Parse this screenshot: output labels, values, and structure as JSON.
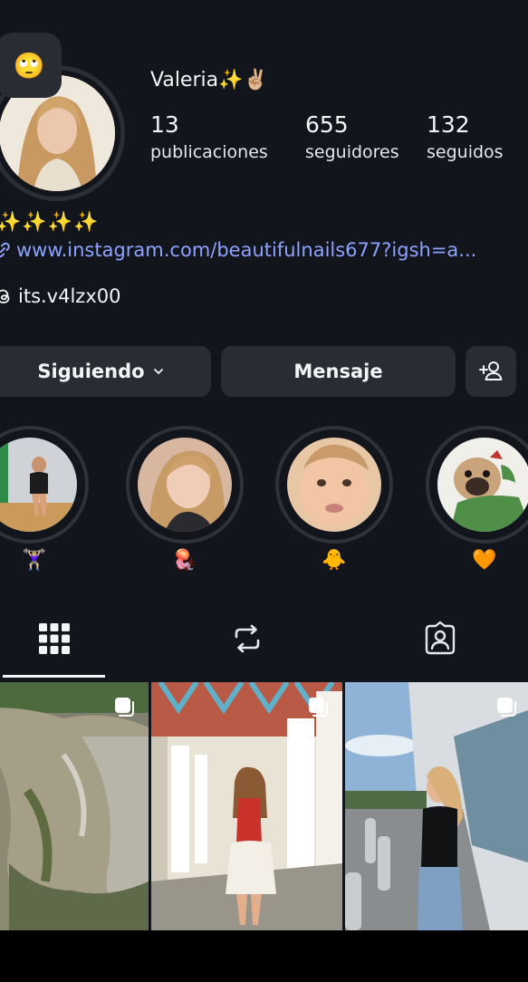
{
  "profile": {
    "note_emoji": "🙄",
    "username": "Valeria✨✌🏼",
    "stats": {
      "posts_count": "13",
      "posts_label": "publicaciones",
      "followers_count": "655",
      "followers_label": "seguidores",
      "following_count": "132",
      "following_label": "seguidos"
    },
    "bio_emoji": "✨✨✨✨",
    "link": "www.instagram.com/beautifulnails677?igsh=a...",
    "threads_handle": "its.v4lzx00"
  },
  "buttons": {
    "following_label": "Siguiendo",
    "message_label": "Mensaje"
  },
  "highlights": [
    {
      "label": "🏋🏼‍♀️"
    },
    {
      "label": "🪼"
    },
    {
      "label": "🐥"
    },
    {
      "label": "🧡"
    }
  ],
  "icons": {
    "link": "link-icon",
    "threads": "threads-icon",
    "chevron": "chevron-down-icon",
    "add_user": "add-user-icon",
    "grid": "grid-icon",
    "reels": "reels-icon",
    "tagged": "tagged-icon",
    "multi_post": "carousel-icon"
  },
  "colors": {
    "background": "#12151b",
    "button": "#292c33",
    "link": "#8ca3ff",
    "text": "#f3f4f6"
  }
}
